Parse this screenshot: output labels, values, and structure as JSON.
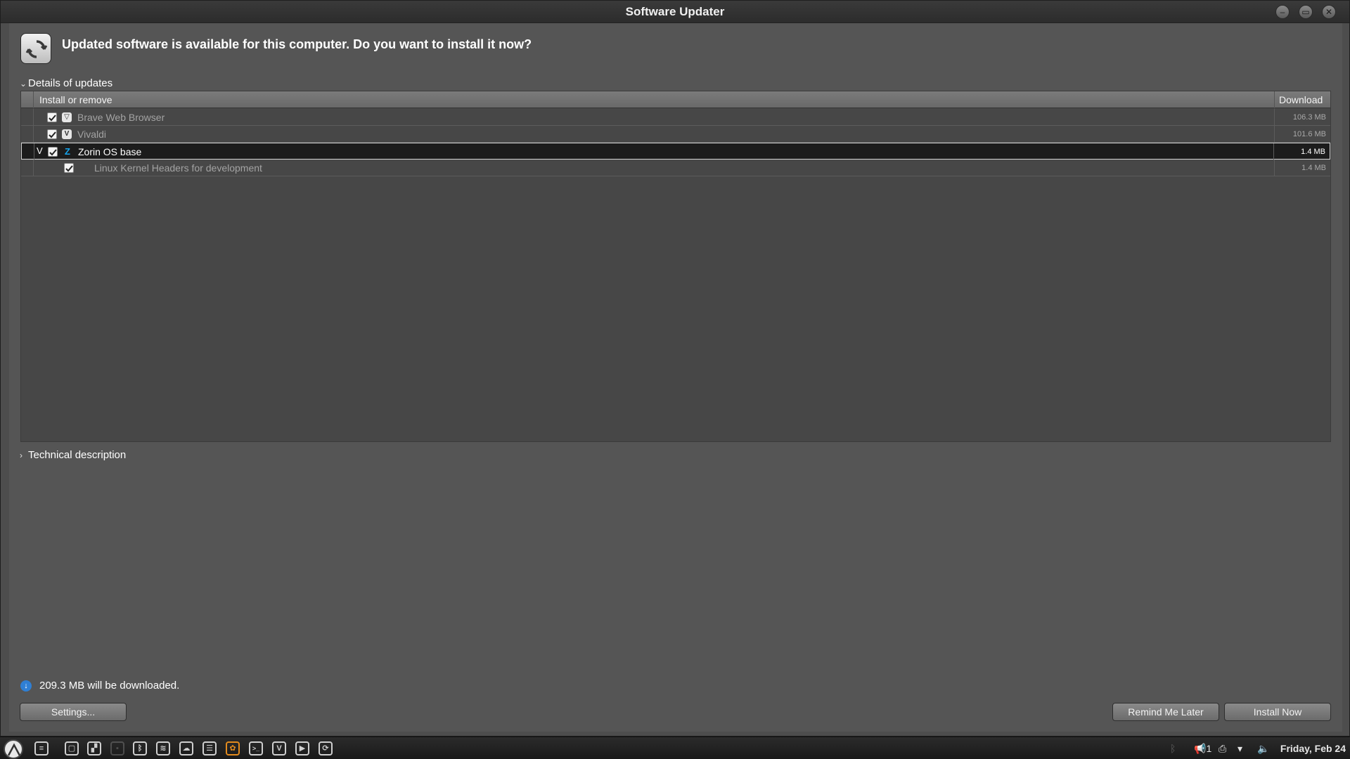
{
  "window": {
    "title": "Software Updater",
    "buttons": {
      "minimize": "–",
      "maximize": "▭",
      "close": "✕"
    }
  },
  "header": {
    "message": "Updated software is available for this computer. Do you want to install it now?"
  },
  "details": {
    "expander_label": "Details of updates",
    "expander_arrow": "⌄",
    "columns": {
      "name": "Install or remove",
      "download": "Download"
    },
    "rows": [
      {
        "name": "Brave Web Browser",
        "size": "106.3 MB",
        "icon": "brave-icon",
        "glyph": "▽",
        "checked": true
      },
      {
        "name": "Vivaldi",
        "size": "101.6 MB",
        "icon": "vivaldi-icon",
        "glyph": "V",
        "checked": true
      },
      {
        "name": "Zorin OS base",
        "size": "1.4 MB",
        "icon": "zorin-icon",
        "glyph": "Z",
        "checked": true,
        "toggle": "V",
        "selected": true
      },
      {
        "name": "Linux Kernel Headers for development",
        "size": "1.4 MB",
        "checked": true,
        "child": true
      }
    ]
  },
  "technical": {
    "expander_label": "Technical description",
    "expander_arrow": "›"
  },
  "footer": {
    "download_info": "209.3 MB will be downloaded.",
    "info_glyph": "↓",
    "settings_label": "Settings...",
    "remind_label": "Remind Me Later",
    "install_label": "Install Now"
  },
  "taskbar": {
    "apps": [
      {
        "name": "files-icon",
        "glyph": "≡"
      },
      {
        "name": "window-icon",
        "glyph": "▢"
      },
      {
        "name": "folder-icon",
        "glyph": "▞"
      },
      {
        "name": "hidden-app-icon",
        "glyph": "▪",
        "faded": true
      },
      {
        "name": "bluetooth-app-icon",
        "glyph": "ᛒ"
      },
      {
        "name": "layers-icon",
        "glyph": "≋"
      },
      {
        "name": "cloud-icon",
        "glyph": "☁"
      },
      {
        "name": "text-editor-icon",
        "glyph": "☰"
      },
      {
        "name": "gimp-icon",
        "glyph": "✿"
      },
      {
        "name": "terminal-icon",
        "glyph": ">_"
      },
      {
        "name": "vivaldi-taskbar-icon",
        "glyph": "V"
      },
      {
        "name": "media-player-icon",
        "glyph": "▶"
      },
      {
        "name": "software-updater-taskbar-icon",
        "glyph": "⟳"
      }
    ],
    "tray": {
      "bluetooth": "ᛒ",
      "notifications": "1",
      "printer": "⎙",
      "wifi": "▾",
      "volume": "🔈"
    },
    "clock": "Friday, Feb 24"
  },
  "colors": {
    "window_bg": "#555555",
    "table_bg": "#474747",
    "selected_row": "#1c1c1c",
    "info_blue": "#2f7fd4",
    "zorin_blue": "#15a6f0"
  }
}
